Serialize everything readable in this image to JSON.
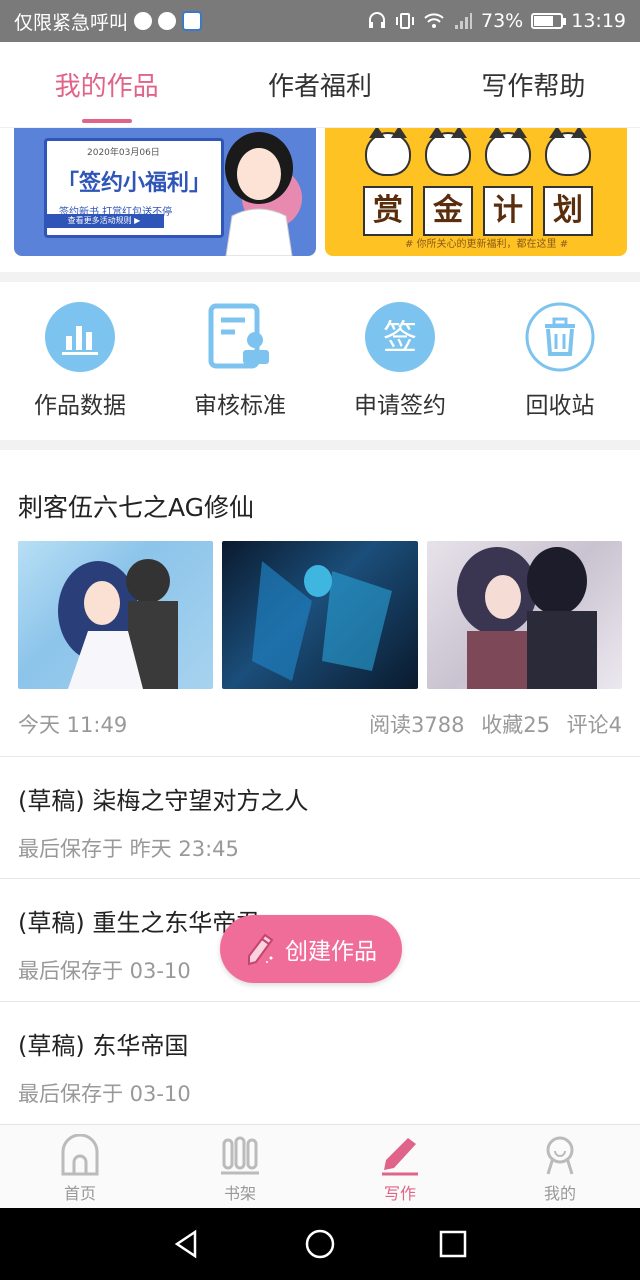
{
  "status_bar": {
    "carrier": "仅限紧急呼叫",
    "battery": "73%",
    "time": "13:19",
    "battery_level": 0.73
  },
  "tabs": [
    {
      "label": "我的作品",
      "active": true
    },
    {
      "label": "作者福利",
      "active": false
    },
    {
      "label": "写作帮助",
      "active": false
    }
  ],
  "banner": {
    "left": {
      "date": "2020年03月06日",
      "title": "「签约小福利」",
      "subtitle": "签约新书  打赏红包送不停",
      "button": "查看更多活动规则 ▶"
    },
    "right": {
      "chars": [
        "赏",
        "金",
        "计",
        "划"
      ],
      "slogan": "# 你所关心的更新福利，都在这里 #"
    }
  },
  "actions": [
    {
      "label": "作品数据",
      "icon": "bar-chart-icon"
    },
    {
      "label": "审核标准",
      "icon": "review-document-icon"
    },
    {
      "label": "申请签约",
      "icon": "sign-contract-icon"
    },
    {
      "label": "回收站",
      "icon": "trash-icon"
    }
  ],
  "work": {
    "title": "刺客伍六七之AG修仙",
    "time": "今天 11:49",
    "stats": [
      "阅读3788",
      "收藏25",
      "评论4"
    ]
  },
  "drafts": [
    {
      "title": "(草稿) 柒梅之守望对方之人",
      "time": "最后保存于 昨天 23:45"
    },
    {
      "title": "(草稿) 重生之东华帝君",
      "time": "最后保存于 03-10"
    },
    {
      "title": "(草稿) 东华帝国",
      "time": "最后保存于 03-10"
    }
  ],
  "fab": {
    "label": "创建作品"
  },
  "bottom_nav": [
    {
      "label": "首页",
      "active": false
    },
    {
      "label": "书架",
      "active": false
    },
    {
      "label": "写作",
      "active": true
    },
    {
      "label": "我的",
      "active": false
    }
  ],
  "colors": {
    "accent": "#e0648a",
    "fab": "#f06d9a",
    "icon_blue": "#7cc4ef"
  }
}
